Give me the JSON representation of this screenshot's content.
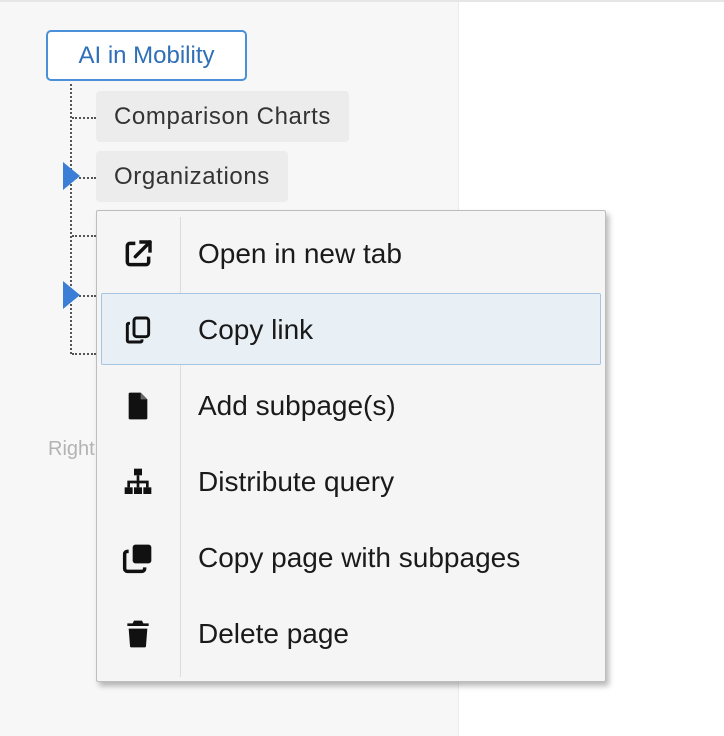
{
  "tree": {
    "root_label": "AI in Mobility",
    "nodes": [
      {
        "label": "Comparison Charts"
      },
      {
        "label": "Organizations"
      }
    ],
    "faded_label": "Right"
  },
  "context_menu": {
    "items": [
      {
        "label": "Open in new tab",
        "icon": "external-link-icon"
      },
      {
        "label": "Copy link",
        "icon": "copy-link-icon"
      },
      {
        "label": "Add subpage(s)",
        "icon": "file-icon"
      },
      {
        "label": "Distribute query",
        "icon": "sitemap-icon"
      },
      {
        "label": "Copy page with subpages",
        "icon": "copy-pages-icon"
      },
      {
        "label": "Delete page",
        "icon": "trash-icon"
      }
    ]
  },
  "colors": {
    "accent": "#3a7fd5",
    "root_text": "#2f6fb8",
    "hover_bg": "#e8f0f5",
    "hover_border": "#a6c5e2"
  }
}
